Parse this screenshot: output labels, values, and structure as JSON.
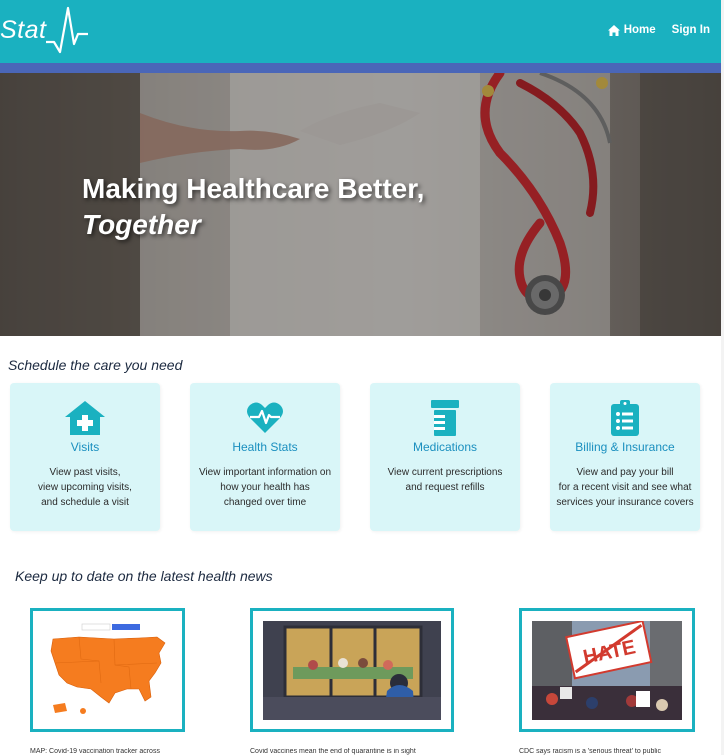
{
  "header": {
    "logo_text": "Stat",
    "nav": [
      {
        "label": "Home",
        "icon": "home-icon"
      },
      {
        "label": "Sign In"
      }
    ]
  },
  "hero": {
    "title_line1": "Making Healthcare Better,",
    "title_line2": "Together"
  },
  "services": {
    "heading": "Schedule the care you need",
    "cards": [
      {
        "title": "Visits",
        "icon": "house-medical-icon",
        "description": "View past visits,\nview upcoming visits,\nand schedule a visit"
      },
      {
        "title": "Health Stats",
        "icon": "heartbeat-icon",
        "description": "View important information on\nhow your health has\nchanged over time"
      },
      {
        "title": "Medications",
        "icon": "prescription-bottle-icon",
        "description": "View current prescriptions\nand request refills"
      },
      {
        "title": "Billing & Insurance",
        "icon": "clipboard-list-icon",
        "description": "View and pay your bill\nfor a recent visit and see what\nservices your insurance covers"
      }
    ]
  },
  "news": {
    "heading": "Keep up to date on the latest health news",
    "articles": [
      {
        "caption": "MAP: Covid-19 vaccination tracker across",
        "image": "us-vaccination-map"
      },
      {
        "caption": "Covid vaccines mean the end of quarantine is in sight",
        "image": "window-gathering-illustration"
      },
      {
        "caption": "CDC says racism is a 'serious threat' to public",
        "image": "hate-protest-sign-photo"
      }
    ]
  },
  "colors": {
    "brand_teal": "#1ab1c0",
    "accent_blue": "#4a66b8",
    "card_bg": "#d9f6f8",
    "card_title": "#1a8fbf"
  }
}
